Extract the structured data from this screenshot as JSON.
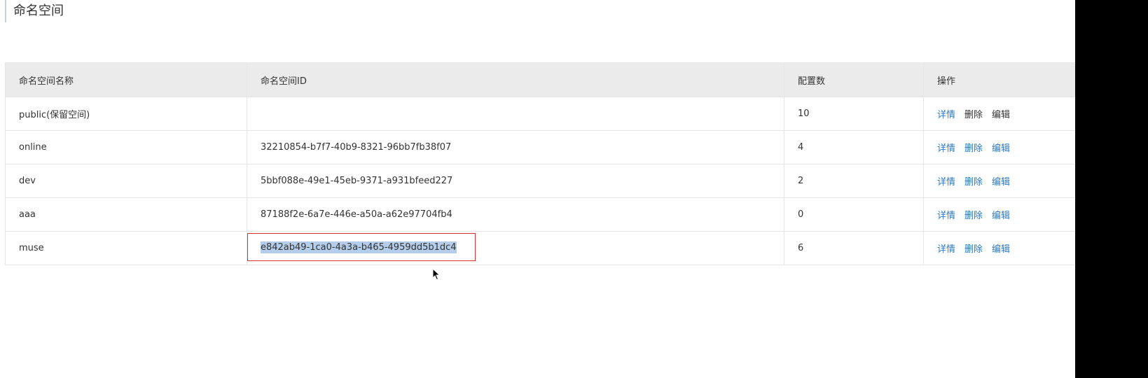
{
  "page": {
    "title": "命名空间"
  },
  "table": {
    "headers": {
      "name": "命名空间名称",
      "id": "命名空间ID",
      "count": "配置数",
      "actions": "操作"
    },
    "rows": [
      {
        "name": "public(保留空间)",
        "id": "",
        "count": "10",
        "detail": "详情",
        "delete": "删除",
        "edit": "编辑"
      },
      {
        "name": "online",
        "id": "32210854-b7f7-40b9-8321-96bb7fb38f07",
        "count": "4",
        "detail": "详情",
        "delete": "删除",
        "edit": "编辑"
      },
      {
        "name": "dev",
        "id": "5bbf088e-49e1-45eb-9371-a931bfeed227",
        "count": "2",
        "detail": "详情",
        "delete": "删除",
        "edit": "编辑"
      },
      {
        "name": "aaa",
        "id": "87188f2e-6a7e-446e-a50a-a62e97704fb4",
        "count": "0",
        "detail": "详情",
        "delete": "删除",
        "edit": "编辑"
      },
      {
        "name": "muse",
        "id": "e842ab49-1ca0-4a3a-b465-4959dd5b1dc4",
        "count": "6",
        "detail": "详情",
        "delete": "删除",
        "edit": "编辑"
      }
    ]
  },
  "colors": {
    "link": "#2e78c2",
    "header_bg": "#ebebeb",
    "selection_bg": "#b4cdea",
    "highlight_border": "#e0302f"
  },
  "icons": {
    "cursor": "mouse-pointer-icon"
  }
}
